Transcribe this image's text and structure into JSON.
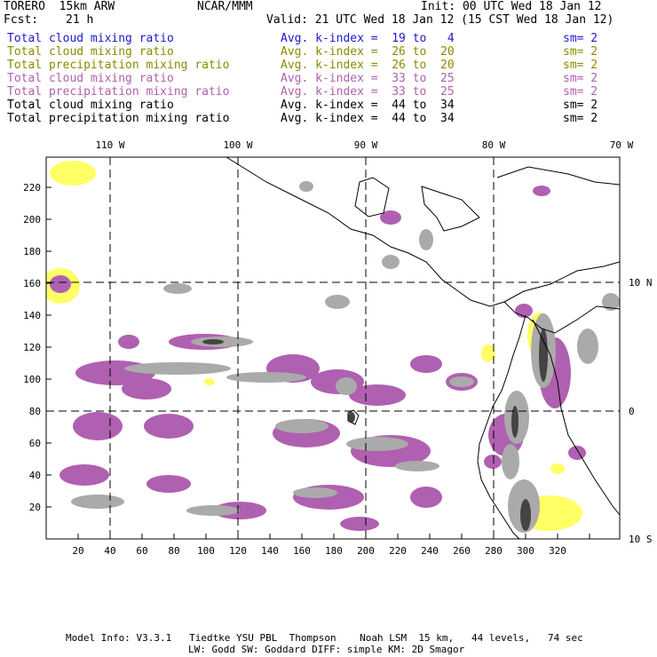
{
  "header": {
    "model": "TORERO  15km ARW",
    "org": "NCAR/MMM",
    "init": "Init: 00 UTC Wed 18 Jan 12",
    "fcst_label": "Fcst:",
    "fcst_value": "21 h",
    "valid": "Valid: 21 UTC Wed 18 Jan 12 (15 CST Wed 18 Jan 12)"
  },
  "legend_rows": [
    {
      "field": "Total cloud mixing ratio",
      "range": "Avg. k-index =  19 to   4",
      "sm": "sm= 2",
      "color": "#1a1acc"
    },
    {
      "field": "Total cloud mixing ratio",
      "range": "Avg. k-index =  26 to  20",
      "sm": "sm= 2",
      "color": "#8a8a00"
    },
    {
      "field": "Total precipitation mixing ratio",
      "range": "Avg. k-index =  26 to  20",
      "sm": "sm= 2",
      "color": "#8a8a00"
    },
    {
      "field": "Total cloud mixing ratio",
      "range": "Avg. k-index =  33 to  25",
      "sm": "sm= 2",
      "color": "#b060b0"
    },
    {
      "field": "Total precipitation mixing ratio",
      "range": "Avg. k-index =  33 to  25",
      "sm": "sm= 2",
      "color": "#b060b0"
    },
    {
      "field": "Total cloud mixing ratio",
      "range": "Avg. k-index =  44 to  34",
      "sm": "sm= 2",
      "color": "#000000"
    },
    {
      "field": "Total precipitation mixing ratio",
      "range": "Avg. k-index =  44 to  34",
      "sm": "sm= 2",
      "color": "#000000"
    }
  ],
  "map": {
    "lon_labels": [
      "110 W",
      "100 W",
      "90 W",
      "80 W",
      "70 W"
    ],
    "lat_labels": [
      "10 N",
      "0",
      "10 S"
    ],
    "x_ticks": [
      "20",
      "40",
      "60",
      "80",
      "100",
      "120",
      "140",
      "160",
      "180",
      "200",
      "220",
      "240",
      "260",
      "280",
      "300",
      "320"
    ],
    "y_ticks": [
      "20",
      "40",
      "60",
      "80",
      "100",
      "120",
      "140",
      "160",
      "180",
      "200",
      "220"
    ],
    "colors": {
      "light": "#ffff66",
      "medium": "#b060b0",
      "heavy": "#aaaaaa",
      "core": "#444444",
      "border": "#000000"
    }
  },
  "footer": {
    "line1": "Model Info: V3.3.1   Tiedtke YSU PBL  Thompson    Noah LSM  15 km,   44 levels,   74 sec",
    "line2": "LW: Godd SW: Goddard DIFF: simple KM: 2D Smagor"
  }
}
